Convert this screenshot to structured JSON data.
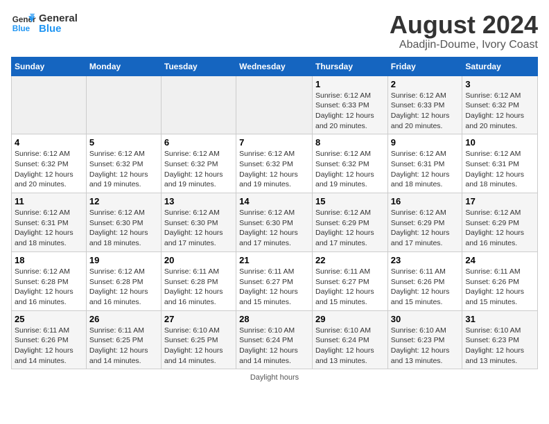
{
  "logo": {
    "line1": "General",
    "line2": "Blue"
  },
  "title": "August 2024",
  "subtitle": "Abadjin-Doume, Ivory Coast",
  "days_of_week": [
    "Sunday",
    "Monday",
    "Tuesday",
    "Wednesday",
    "Thursday",
    "Friday",
    "Saturday"
  ],
  "weeks": [
    [
      {
        "day": "",
        "detail": ""
      },
      {
        "day": "",
        "detail": ""
      },
      {
        "day": "",
        "detail": ""
      },
      {
        "day": "",
        "detail": ""
      },
      {
        "day": "1",
        "detail": "Sunrise: 6:12 AM\nSunset: 6:33 PM\nDaylight: 12 hours\nand 20 minutes."
      },
      {
        "day": "2",
        "detail": "Sunrise: 6:12 AM\nSunset: 6:33 PM\nDaylight: 12 hours\nand 20 minutes."
      },
      {
        "day": "3",
        "detail": "Sunrise: 6:12 AM\nSunset: 6:32 PM\nDaylight: 12 hours\nand 20 minutes."
      }
    ],
    [
      {
        "day": "4",
        "detail": "Sunrise: 6:12 AM\nSunset: 6:32 PM\nDaylight: 12 hours\nand 20 minutes."
      },
      {
        "day": "5",
        "detail": "Sunrise: 6:12 AM\nSunset: 6:32 PM\nDaylight: 12 hours\nand 19 minutes."
      },
      {
        "day": "6",
        "detail": "Sunrise: 6:12 AM\nSunset: 6:32 PM\nDaylight: 12 hours\nand 19 minutes."
      },
      {
        "day": "7",
        "detail": "Sunrise: 6:12 AM\nSunset: 6:32 PM\nDaylight: 12 hours\nand 19 minutes."
      },
      {
        "day": "8",
        "detail": "Sunrise: 6:12 AM\nSunset: 6:32 PM\nDaylight: 12 hours\nand 19 minutes."
      },
      {
        "day": "9",
        "detail": "Sunrise: 6:12 AM\nSunset: 6:31 PM\nDaylight: 12 hours\nand 18 minutes."
      },
      {
        "day": "10",
        "detail": "Sunrise: 6:12 AM\nSunset: 6:31 PM\nDaylight: 12 hours\nand 18 minutes."
      }
    ],
    [
      {
        "day": "11",
        "detail": "Sunrise: 6:12 AM\nSunset: 6:31 PM\nDaylight: 12 hours\nand 18 minutes."
      },
      {
        "day": "12",
        "detail": "Sunrise: 6:12 AM\nSunset: 6:30 PM\nDaylight: 12 hours\nand 18 minutes."
      },
      {
        "day": "13",
        "detail": "Sunrise: 6:12 AM\nSunset: 6:30 PM\nDaylight: 12 hours\nand 17 minutes."
      },
      {
        "day": "14",
        "detail": "Sunrise: 6:12 AM\nSunset: 6:30 PM\nDaylight: 12 hours\nand 17 minutes."
      },
      {
        "day": "15",
        "detail": "Sunrise: 6:12 AM\nSunset: 6:29 PM\nDaylight: 12 hours\nand 17 minutes."
      },
      {
        "day": "16",
        "detail": "Sunrise: 6:12 AM\nSunset: 6:29 PM\nDaylight: 12 hours\nand 17 minutes."
      },
      {
        "day": "17",
        "detail": "Sunrise: 6:12 AM\nSunset: 6:29 PM\nDaylight: 12 hours\nand 16 minutes."
      }
    ],
    [
      {
        "day": "18",
        "detail": "Sunrise: 6:12 AM\nSunset: 6:28 PM\nDaylight: 12 hours\nand 16 minutes."
      },
      {
        "day": "19",
        "detail": "Sunrise: 6:12 AM\nSunset: 6:28 PM\nDaylight: 12 hours\nand 16 minutes."
      },
      {
        "day": "20",
        "detail": "Sunrise: 6:11 AM\nSunset: 6:28 PM\nDaylight: 12 hours\nand 16 minutes."
      },
      {
        "day": "21",
        "detail": "Sunrise: 6:11 AM\nSunset: 6:27 PM\nDaylight: 12 hours\nand 15 minutes."
      },
      {
        "day": "22",
        "detail": "Sunrise: 6:11 AM\nSunset: 6:27 PM\nDaylight: 12 hours\nand 15 minutes."
      },
      {
        "day": "23",
        "detail": "Sunrise: 6:11 AM\nSunset: 6:26 PM\nDaylight: 12 hours\nand 15 minutes."
      },
      {
        "day": "24",
        "detail": "Sunrise: 6:11 AM\nSunset: 6:26 PM\nDaylight: 12 hours\nand 15 minutes."
      }
    ],
    [
      {
        "day": "25",
        "detail": "Sunrise: 6:11 AM\nSunset: 6:26 PM\nDaylight: 12 hours\nand 14 minutes."
      },
      {
        "day": "26",
        "detail": "Sunrise: 6:11 AM\nSunset: 6:25 PM\nDaylight: 12 hours\nand 14 minutes."
      },
      {
        "day": "27",
        "detail": "Sunrise: 6:10 AM\nSunset: 6:25 PM\nDaylight: 12 hours\nand 14 minutes."
      },
      {
        "day": "28",
        "detail": "Sunrise: 6:10 AM\nSunset: 6:24 PM\nDaylight: 12 hours\nand 14 minutes."
      },
      {
        "day": "29",
        "detail": "Sunrise: 6:10 AM\nSunset: 6:24 PM\nDaylight: 12 hours\nand 13 minutes."
      },
      {
        "day": "30",
        "detail": "Sunrise: 6:10 AM\nSunset: 6:23 PM\nDaylight: 12 hours\nand 13 minutes."
      },
      {
        "day": "31",
        "detail": "Sunrise: 6:10 AM\nSunset: 6:23 PM\nDaylight: 12 hours\nand 13 minutes."
      }
    ]
  ],
  "footer": "Daylight hours"
}
